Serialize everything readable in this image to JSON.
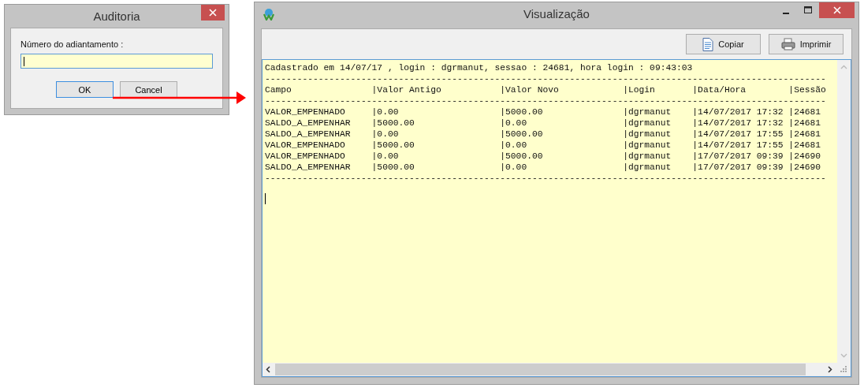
{
  "dialog": {
    "title": "Auditoria",
    "field_label": "Número do adiantamento :",
    "buttons": [
      {
        "label": "OK",
        "default": true
      },
      {
        "label": "Cancel",
        "default": false
      }
    ]
  },
  "viewer": {
    "title": "Visualização",
    "toolbar": [
      {
        "label": "Copiar",
        "kind": "copy"
      },
      {
        "label": "Imprimir",
        "kind": "print"
      }
    ],
    "report_lines": [
      "Cadastrado em 14/07/17 , login : dgrmanut, sessao : 24681, hora login : 09:43:03",
      "---------------------------------------------------------------------------------------------------------",
      "Campo               |Valor Antigo           |Valor Novo            |Login       |Data/Hora        |Sessão",
      "---------------------------------------------------------------------------------------------------------",
      "VALOR_EMPENHADO     |0.00                   |5000.00               |dgrmanut    |14/07/2017 17:32 |24681",
      "SALDO_A_EMPENHAR    |5000.00                |0.00                  |dgrmanut    |14/07/2017 17:32 |24681",
      "SALDO_A_EMPENHAR    |0.00                   |5000.00               |dgrmanut    |14/07/2017 17:55 |24681",
      "VALOR_EMPENHADO     |5000.00                |0.00                  |dgrmanut    |14/07/2017 17:55 |24681",
      "VALOR_EMPENHADO     |0.00                   |5000.00               |dgrmanut    |17/07/2017 09:39 |24690",
      "SALDO_A_EMPENHAR    |5000.00                |0.00                  |dgrmanut    |17/07/2017 09:39 |24690",
      "---------------------------------------------------------------------------------------------------------"
    ]
  }
}
